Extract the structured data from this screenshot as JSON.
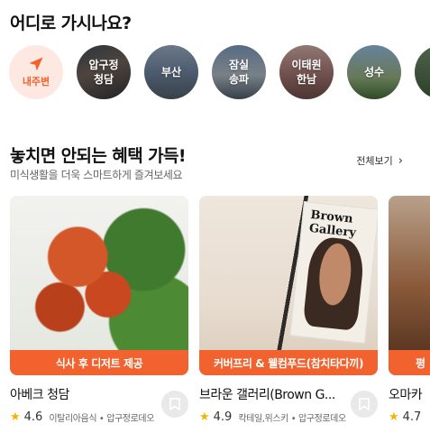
{
  "location_section": {
    "title": "어디로 가시나요?",
    "items": [
      {
        "label": "내주변",
        "icon": "navigation-arrow-icon"
      },
      {
        "label": "압구정\n청담"
      },
      {
        "label": "부산"
      },
      {
        "label": "잠실\n송파"
      },
      {
        "label": "이태원\n한남"
      },
      {
        "label": "성수"
      }
    ]
  },
  "benefit_section": {
    "title": "놓치면 안되는 혜택 가득!",
    "subtitle": "미식생활을 더욱 스마트하게 즐겨보세요",
    "view_all": "전체보기",
    "cards": [
      {
        "banner": "식사 후 디저트 제공",
        "name": "아베크 청담",
        "rating": "4.6",
        "meta": "이탈리아음식 • 압구정로데오"
      },
      {
        "banner": "커버프리 & 웰컴푸드(참치타다끼)",
        "name": "브라운 갤러리(Brown G...",
        "rating": "4.9",
        "meta": "칵테일,위스키 • 압구정로데오",
        "poster_text": "Brown Gallery"
      },
      {
        "banner": "평",
        "name": "오마카",
        "rating": "4.7"
      }
    ]
  },
  "colors": {
    "accent": "#f2622e",
    "star": "#f5b301"
  }
}
